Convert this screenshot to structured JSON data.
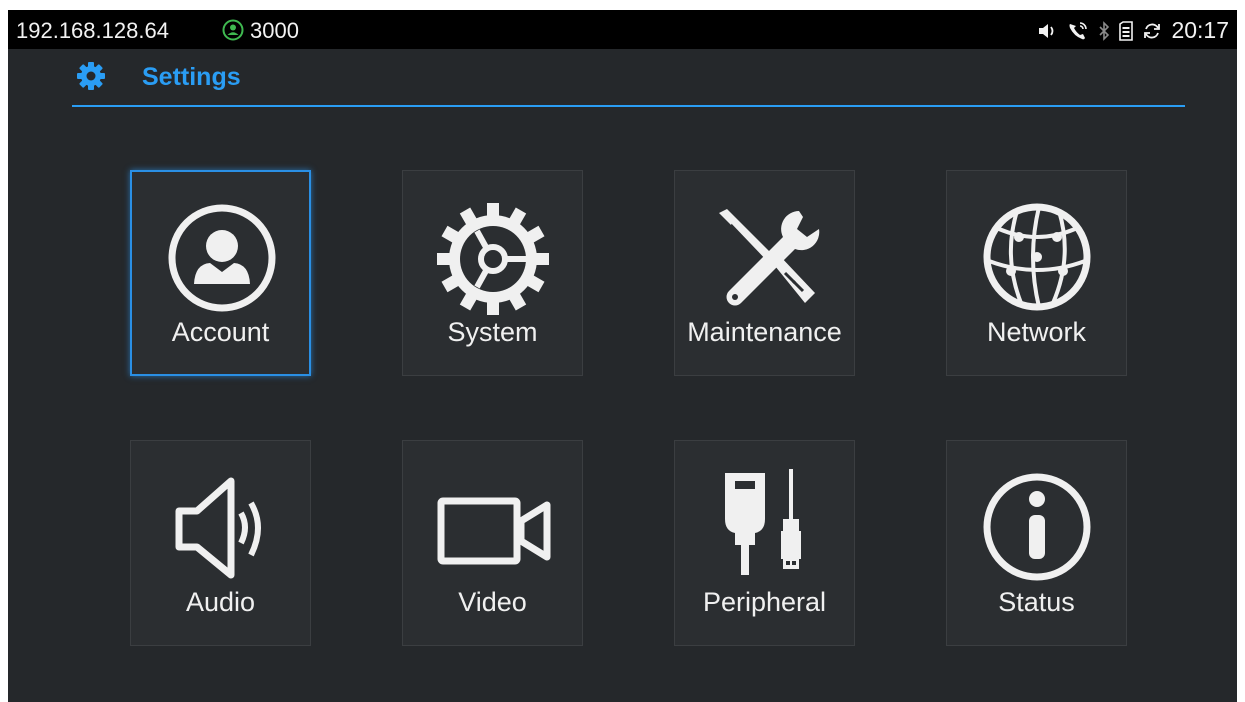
{
  "status_bar": {
    "ip": "192.168.128.64",
    "account": "3000",
    "time": "20:17",
    "icons": [
      "speaker-icon",
      "call-forward-icon",
      "bluetooth-icon",
      "sd-card-icon",
      "sync-icon"
    ]
  },
  "header": {
    "title": "Settings",
    "icon": "gear-icon"
  },
  "tiles": [
    {
      "label": "Account",
      "icon": "account-icon",
      "selected": true
    },
    {
      "label": "System",
      "icon": "system-gear-icon",
      "selected": false
    },
    {
      "label": "Maintenance",
      "icon": "tools-icon",
      "selected": false
    },
    {
      "label": "Network",
      "icon": "globe-icon",
      "selected": false
    },
    {
      "label": "Audio",
      "icon": "speaker-icon",
      "selected": false
    },
    {
      "label": "Video",
      "icon": "video-camera-icon",
      "selected": false
    },
    {
      "label": "Peripheral",
      "icon": "plug-usb-icon",
      "selected": false
    },
    {
      "label": "Status",
      "icon": "info-icon",
      "selected": false
    }
  ],
  "colors": {
    "accent": "#2a9df4",
    "background": "#25282b",
    "tile_border": "#3b3e41",
    "status_bar": "#000000",
    "account_badge": "#3fb950"
  }
}
